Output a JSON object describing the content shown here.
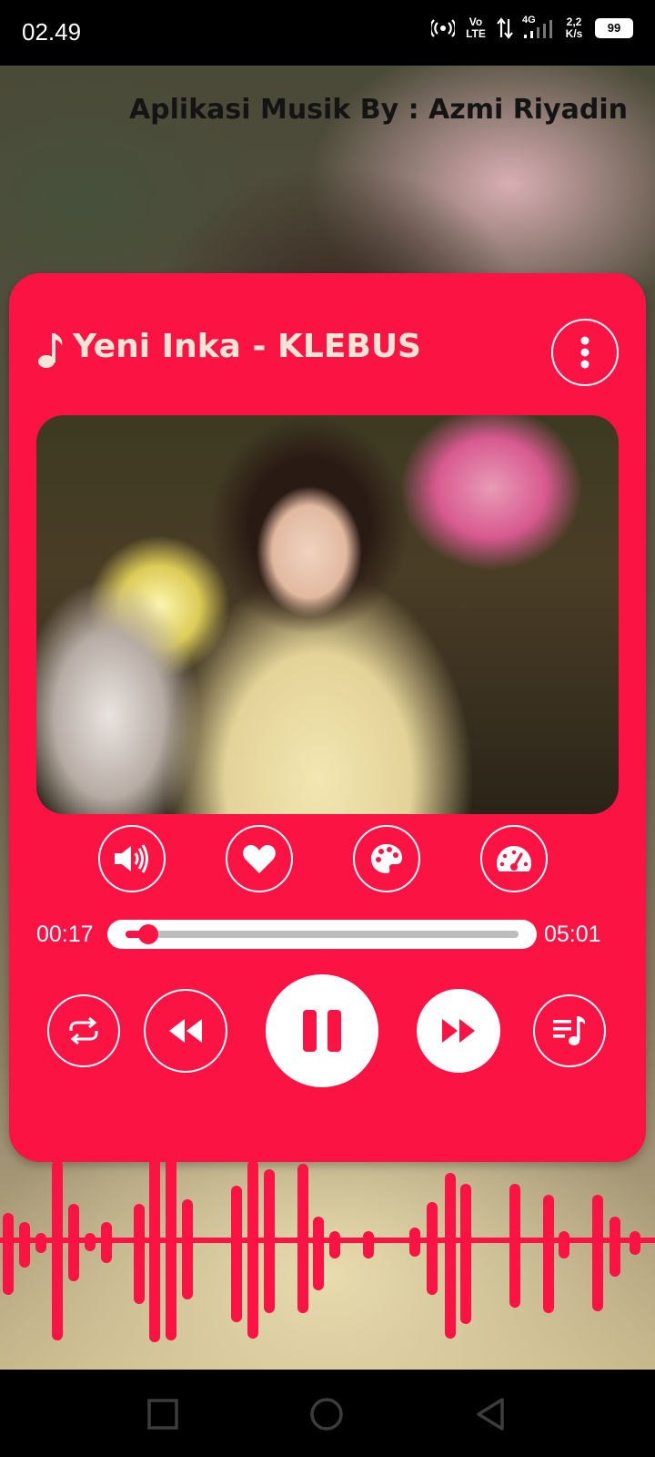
{
  "status_bar": {
    "time": "02.49",
    "network_volte": "Vo LTE",
    "network_type": "4G",
    "speed": "2,2 K/s",
    "battery": "99"
  },
  "app": {
    "credit": "Aplikasi Musik By : Azmi Riyadin"
  },
  "player": {
    "title": "Yeni Inka - KLEBUS",
    "elapsed": "00:17",
    "duration": "05:01",
    "progress": 0.057,
    "accent_color": "#fb1443",
    "controls_top": [
      {
        "name": "volume-button",
        "icon": "volume-icon"
      },
      {
        "name": "favorite-button",
        "icon": "heart-icon"
      },
      {
        "name": "theme-button",
        "icon": "palette-icon"
      },
      {
        "name": "speed-button",
        "icon": "speedometer-icon"
      }
    ],
    "controls_bottom": [
      {
        "name": "repeat-button",
        "icon": "repeat-icon"
      },
      {
        "name": "rewind-button",
        "icon": "rewind-icon"
      },
      {
        "name": "pause-button",
        "icon": "pause-icon"
      },
      {
        "name": "fast-forward-button",
        "icon": "fast-forward-icon"
      },
      {
        "name": "playlist-button",
        "icon": "playlist-icon"
      }
    ]
  },
  "nav": {
    "icons": [
      "recents-icon",
      "home-icon",
      "back-icon"
    ]
  }
}
